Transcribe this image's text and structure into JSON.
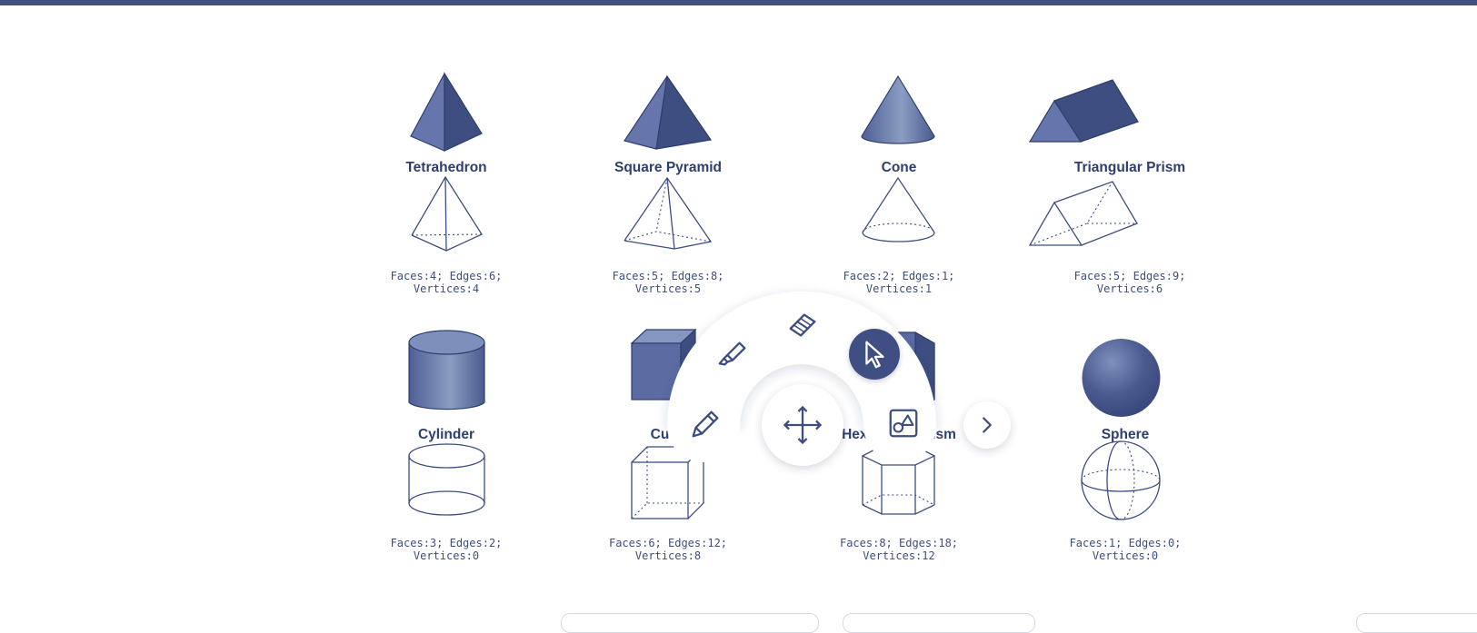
{
  "shapes": [
    {
      "name": "Tetrahedron",
      "stats_line1": "Faces:4; Edges:6;",
      "stats_line2": "Vertices:4"
    },
    {
      "name": "Square Pyramid",
      "stats_line1": "Faces:5; Edges:8;",
      "stats_line2": "Vertices:5"
    },
    {
      "name": "Cone",
      "stats_line1": "Faces:2; Edges:1;",
      "stats_line2": "Vertices:1"
    },
    {
      "name": "Triangular Prism",
      "stats_line1": "Faces:5; Edges:9;",
      "stats_line2": "Vertices:6"
    },
    {
      "name": "Cylinder",
      "stats_line1": "Faces:3; Edges:2;",
      "stats_line2": "Vertices:0"
    },
    {
      "name": "Cube",
      "stats_line1": "Faces:6; Edges:12;",
      "stats_line2": "Vertices:8"
    },
    {
      "name": "Hexagonal Prism",
      "stats_line1": "Faces:8; Edges:18;",
      "stats_line2": "Vertices:12"
    },
    {
      "name": "Sphere",
      "stats_line1": "Faces:1; Edges:0;",
      "stats_line2": "Vertices:0"
    }
  ],
  "radial_menu": {
    "tools": [
      {
        "icon": "pencil-icon",
        "active": false
      },
      {
        "icon": "highlighter-icon",
        "active": false
      },
      {
        "icon": "eraser-icon",
        "active": false
      },
      {
        "icon": "pointer-icon",
        "active": true
      },
      {
        "icon": "shapes-icon",
        "active": false
      },
      {
        "icon": "move-icon",
        "active": false
      },
      {
        "icon": "chevron-right-icon",
        "active": false
      }
    ]
  },
  "colors": {
    "brand": "#44507f",
    "shape_fill": "#5b6ca3",
    "shape_dark": "#3e4e80",
    "text": "#2e3f6e"
  }
}
